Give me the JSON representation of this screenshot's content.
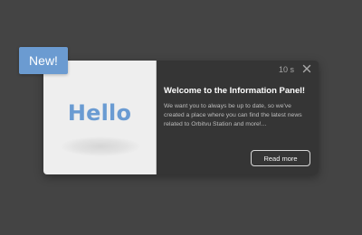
{
  "badge": {
    "label": "New!"
  },
  "preview": {
    "text": "Hello"
  },
  "panel": {
    "timer": "10 s",
    "close_icon": "close-icon",
    "title": "Welcome to the Information Panel!",
    "body": "We want you to always be up to date, so we've created a place where you can find the latest news related to Orbitvu Station and more!...",
    "button_label": "Read more"
  },
  "colors": {
    "background": "#444444",
    "badge": "#6b9bd1",
    "hello_text": "#6a9bd2",
    "panel_dark": "#353535",
    "preview_bg": "#eeeeee"
  }
}
